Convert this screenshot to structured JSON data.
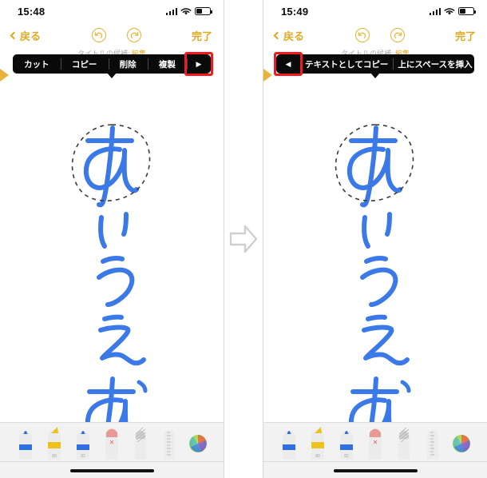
{
  "meta": {
    "app": "Notes handwriting editor",
    "accent_gold": "#e0a81f",
    "ink_blue": "#3b79e8",
    "menu_bg": "#0a0a0a",
    "highlight_red": "#ee1c1c",
    "palette_bg": "#f2f2f2"
  },
  "panels": [
    {
      "id": "before",
      "status": {
        "time": "15:48",
        "signal_icon": "cellular-bars-icon",
        "wifi_icon": "wifi-icon",
        "battery_icon": "battery-icon"
      },
      "nav": {
        "back_label": "戻る",
        "back_icon": "chevron-left-icon",
        "undo_icon": "undo-icon",
        "redo_icon": "redo-icon",
        "done_label": "完了"
      },
      "title_hint": {
        "prefix": "タイトルの候補: ",
        "edit_label": "編集"
      },
      "context_menu": {
        "items": [
          {
            "label": "カット",
            "name": "menu-item-cut"
          },
          {
            "label": "コピー",
            "name": "menu-item-copy"
          },
          {
            "label": "削除",
            "name": "menu-item-delete"
          },
          {
            "label": "複製",
            "name": "menu-item-duplicate"
          }
        ],
        "next_arrow": "▶",
        "next_arrow_icon": "chevron-right-icon",
        "highlighted": "next-arrow"
      },
      "ink_text": "あいうえお",
      "selection": {
        "character": "あ",
        "style": "dashed-lasso"
      }
    },
    {
      "id": "after",
      "status": {
        "time": "15:49",
        "signal_icon": "cellular-bars-icon",
        "wifi_icon": "wifi-icon",
        "battery_icon": "battery-icon"
      },
      "nav": {
        "back_label": "戻る",
        "back_icon": "chevron-left-icon",
        "undo_icon": "undo-icon",
        "redo_icon": "redo-icon",
        "done_label": "完了"
      },
      "title_hint": {
        "prefix": "タイトルの候補: ",
        "edit_label": "編集"
      },
      "context_menu": {
        "prev_arrow": "◀",
        "prev_arrow_icon": "chevron-left-icon",
        "items": [
          {
            "label": "テキストとしてコピー",
            "name": "menu-item-copy-as-text"
          },
          {
            "label": "上にスペースを挿入",
            "name": "menu-item-insert-space-above"
          }
        ],
        "next_arrow": "▶",
        "next_arrow_icon": "chevron-right-icon",
        "highlighted": "prev-arrow"
      },
      "ink_text": "あいうえお",
      "selection": {
        "character": "あ",
        "style": "dashed-lasso"
      }
    }
  ],
  "transition": {
    "icon": "arrow-right-outline-icon"
  },
  "palette": {
    "tools": [
      {
        "name": "pen-tool",
        "label": "ペン",
        "color": "#2f6fe0"
      },
      {
        "name": "highlighter-tool",
        "label": "蛍光ペン",
        "color": "#edc21f"
      },
      {
        "name": "pencil-tool",
        "label": "鉛筆",
        "color": "#2f6fe0"
      },
      {
        "name": "eraser-tool",
        "label": "消しゴム",
        "color": "#e79a94"
      },
      {
        "name": "lasso-tool",
        "label": "なげなわ",
        "color": "#b9b9b9"
      },
      {
        "name": "ruler-tool",
        "label": "定規",
        "color": "#cfcfcf"
      },
      {
        "name": "color-picker",
        "label": "カラー",
        "color": "#8bc34a"
      }
    ]
  }
}
